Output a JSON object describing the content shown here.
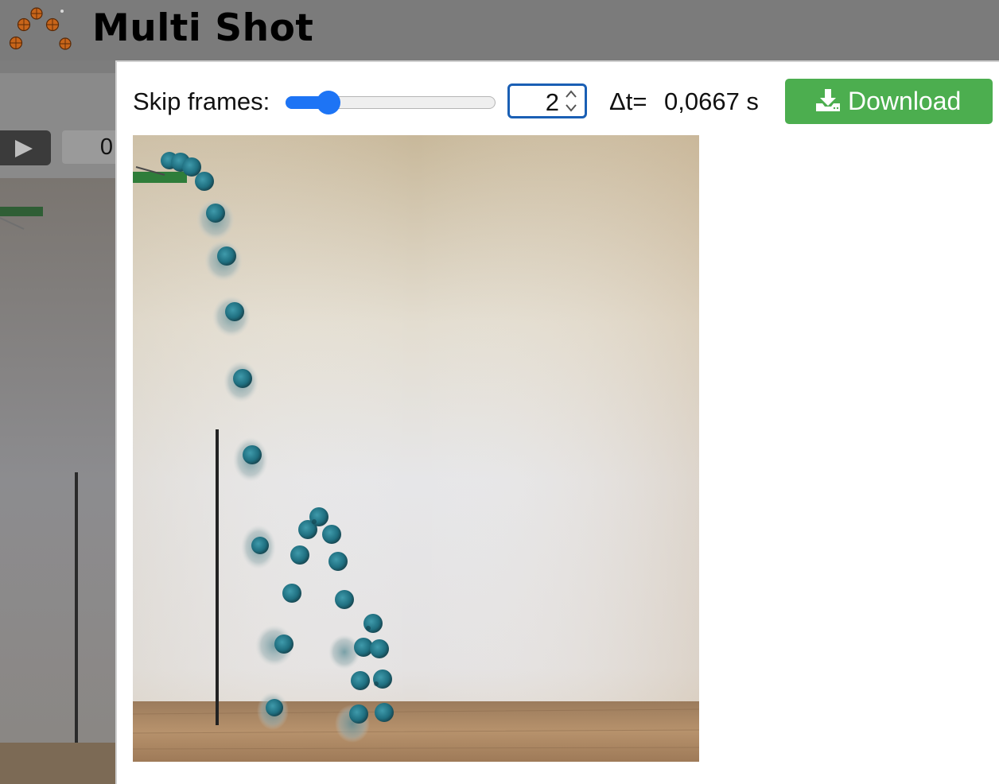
{
  "header": {
    "title": "Multi Shot",
    "logo_icon": "basketballs-logo-icon"
  },
  "video_panel": {
    "play_icon": "play-icon",
    "frame_value": "0"
  },
  "multishot": {
    "skip_label": "Skip frames:",
    "skip_slider_value": 0.15,
    "skip_value": "2",
    "dt_label": "Δt=",
    "dt_value": "0,0667 s",
    "download_label": "Download",
    "download_icon": "download-icon"
  },
  "colors": {
    "header_bg": "#7b7b7b",
    "accent_blue": "#1d74f5",
    "download_green": "#4cae4f",
    "ball_teal": "#1f6f80"
  }
}
